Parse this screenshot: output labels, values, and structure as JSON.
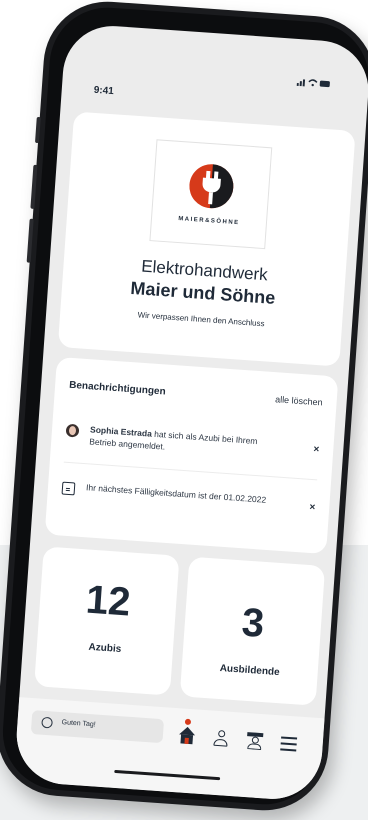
{
  "status_bar": {
    "time": "9:41"
  },
  "company": {
    "logo_text": "MAIER&SÖHNE",
    "line1": "Elektrohandwerk",
    "line2": "Maier und Söhne",
    "slogan": "Wir verpassen Ihnen den Anschluss",
    "brand_color": "#d63a1a"
  },
  "notifications": {
    "title": "Benachrichtigungen",
    "clear_label": "alle löschen",
    "items": [
      {
        "icon": "avatar-icon",
        "name": "Sophia Estrada",
        "text": " hat sich als Azubi bei Ihrem Betrieb angemeldet.",
        "close": "×"
      },
      {
        "icon": "document-icon",
        "text": "Ihr nächstes Fälligkeitsdatum ist der 01.02.2022",
        "close": "×"
      }
    ]
  },
  "stats": [
    {
      "value": "12",
      "label": "Azubis"
    },
    {
      "value": "3",
      "label": "Ausbildende"
    }
  ],
  "tabbar": {
    "greeting": "Guten Tag!",
    "icons": [
      "home-icon",
      "person-icon",
      "graduation-icon",
      "menu-icon"
    ]
  }
}
